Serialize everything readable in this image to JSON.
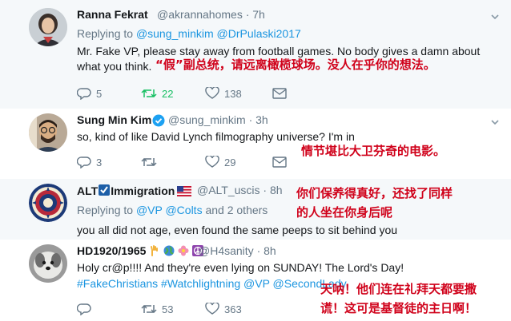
{
  "tweets": [
    {
      "name": "Ranna Fekrat",
      "handle": "@akrannahomes",
      "time": "· 7h",
      "replying_prefix": "Replying to",
      "replying_links": "@sung_minkim @DrPulaski2017",
      "body_lines": [
        "Mr. Fake VP, please stay away from football games. No body gives a damn about",
        "what you think."
      ],
      "translation": "“假”副总统，请远离橄榄球场。没人在乎你的想法。",
      "counts": {
        "replies": "5",
        "retweets": "22",
        "likes": "138"
      }
    },
    {
      "name": "Sung Min Kim",
      "handle": "@sung_minkim",
      "time": "· 3h",
      "body_lines": [
        "so, kind of like David Lynch filmography universe? I'm in"
      ],
      "translation": "情节堪比大卫芬奇的电影。",
      "counts": {
        "replies": "3",
        "retweets": "",
        "likes": "29"
      }
    },
    {
      "name_prefix": "ALT",
      "name_suffix": "Immigration",
      "handle": "@ALT_uscis",
      "time": "· 8h",
      "replying_prefix": "Replying to",
      "replying_links": "@VP @Colts",
      "replying_suffix": "and 2 others",
      "body_lines": [
        "you all did not age, even found the same peeps to sit behind you"
      ],
      "translation_lines": [
        "你们保养得真好，还找了同样",
        "的人坐在你身后呢"
      ]
    },
    {
      "name": "HD1920/1965",
      "handle": "@H4sanity",
      "time": "· 8h",
      "body_lines": [
        "Holy cr@p!!!! And they're even lying on SUNDAY! The Lord's Day!"
      ],
      "hashtags": "#FakeChristians #Watchlightning @VP @SecondLady",
      "translation_lines": [
        "天呐！他们连在礼拜天都要撒",
        "谎！这可是基督徒的主日啊！"
      ],
      "counts": {
        "replies": "",
        "retweets": "53",
        "likes": "363"
      }
    }
  ],
  "colors": {
    "link": "#1b95e0",
    "muted": "#657786",
    "translation": "#d0021b",
    "retweet_active": "#17bf63",
    "verified": "#1da1f2"
  },
  "icons": [
    "reply-icon",
    "retweet-icon",
    "like-icon",
    "mail-icon",
    "chevron-down-icon",
    "verified-icon"
  ]
}
